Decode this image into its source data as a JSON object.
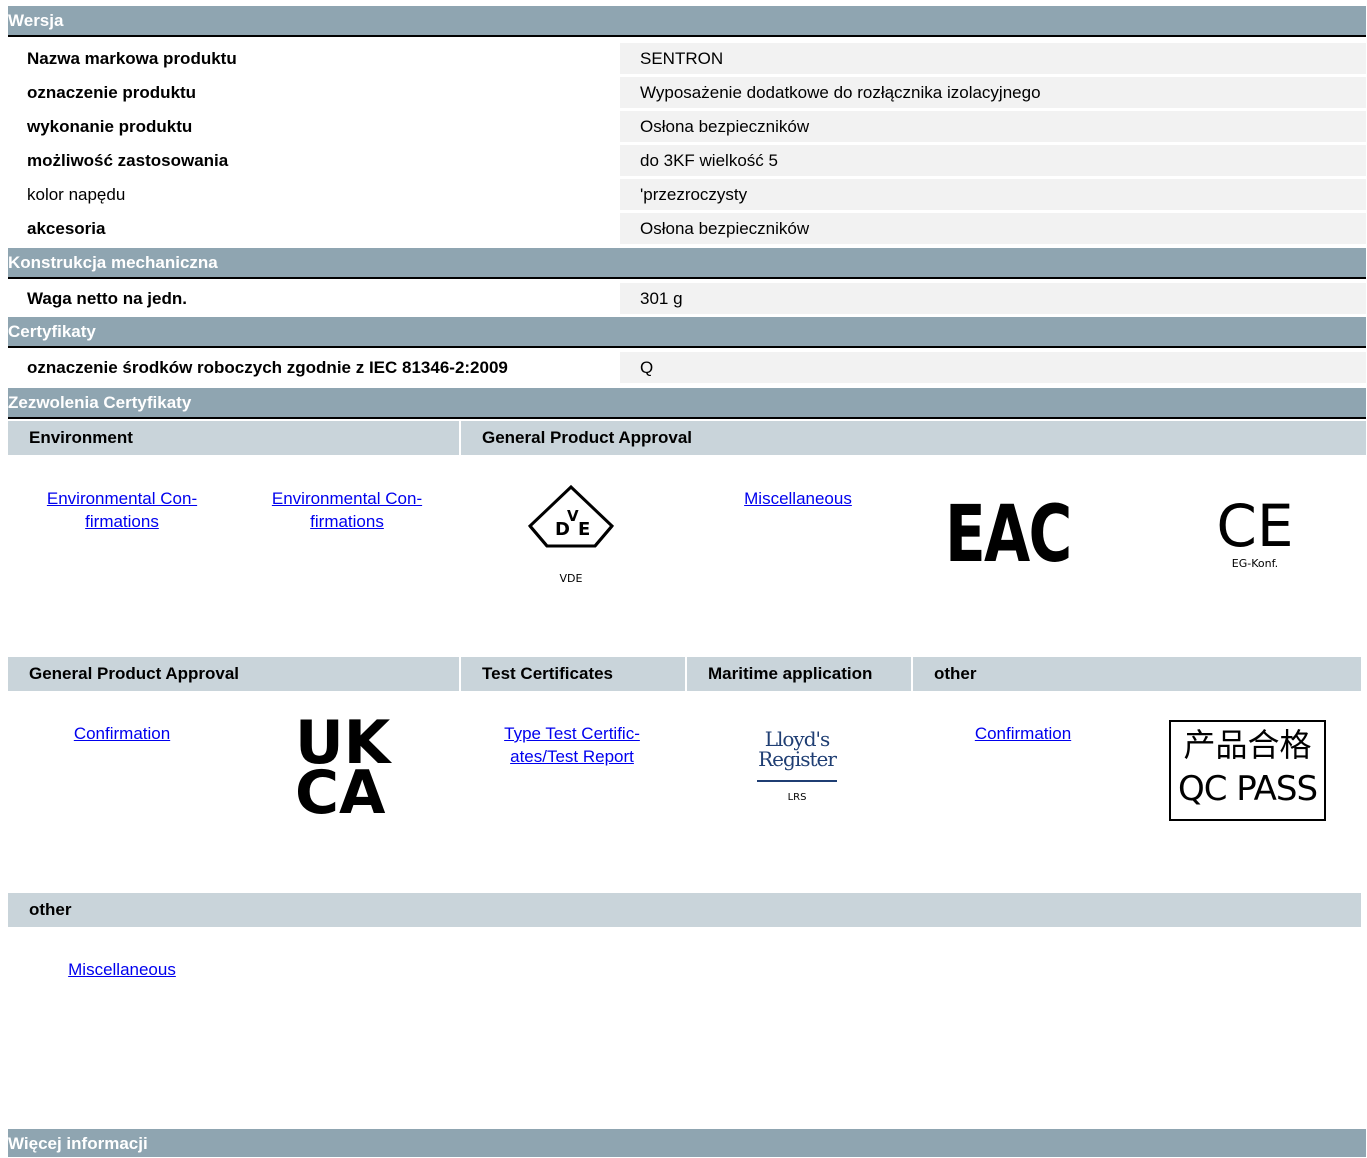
{
  "sections": {
    "wersja": "Wersja",
    "mech": "Konstrukcja mechaniczna",
    "cert": "Certyfikaty",
    "zezwolenia": "Zezwolenia Certyfikaty",
    "wiecej": "Więcej informacji"
  },
  "wersja_rows": [
    {
      "label": "Nazwa markowa produktu",
      "value": "SENTRON"
    },
    {
      "label": "oznaczenie produktu",
      "value": "Wyposażenie dodatkowe do rozłącznika izolacyjnego"
    },
    {
      "label": "wykonanie produktu",
      "value": "Osłona bezpieczników"
    },
    {
      "label": "możliwość zastosowania",
      "value": "do 3KF wielkość 5"
    },
    {
      "label": "kolor napędu",
      "value": "'przezroczysty"
    },
    {
      "label": "akcesoria",
      "value": "Osłona bezpieczników"
    }
  ],
  "mech_rows": [
    {
      "label": "Waga netto na jedn.",
      "value": "301 g"
    }
  ],
  "cert_rows": [
    {
      "label": "oznaczenie środków roboczych zgodnie z IEC 81346-2:2009",
      "value": "Q"
    }
  ],
  "approvals": {
    "group1": {
      "header_environment": "Environment",
      "header_general": "General Product Approval",
      "link_env1": "Environmental Con-\nfirmations",
      "link_env2": "Environmental Con-\nfirmations",
      "link_misc": "Miscellaneous",
      "logo_vde": "VDE",
      "logo_vde_letters": "DVE",
      "logo_eac": "EAC",
      "logo_ce": "CE",
      "logo_ce_sub": "EG-Konf."
    },
    "group2": {
      "header_general": "General Product Approval",
      "header_test": "Test Certificates",
      "header_maritime": "Maritime application",
      "header_other": "other",
      "link_confirmation1": "Confirmation",
      "logo_ukca_top": "UK",
      "logo_ukca_bottom": "CA",
      "link_type_test": "Type Test Certific-\nates/Test Report",
      "logo_lloyds_line1": "Lloyd's",
      "logo_lloyds_line2": "Register",
      "logo_lloyds_sub": "LRS",
      "link_confirmation2": "Confirmation",
      "logo_qc_line1": "产品合格",
      "logo_qc_line2": "QC PASS"
    },
    "group3": {
      "header_other": "other",
      "link_misc": "Miscellaneous"
    }
  },
  "colors": {
    "section_bg": "#8fa5b1",
    "sub_header_bg": "#c9d4da",
    "value_bg": "#f2f2f2",
    "link": "#0000ee"
  }
}
